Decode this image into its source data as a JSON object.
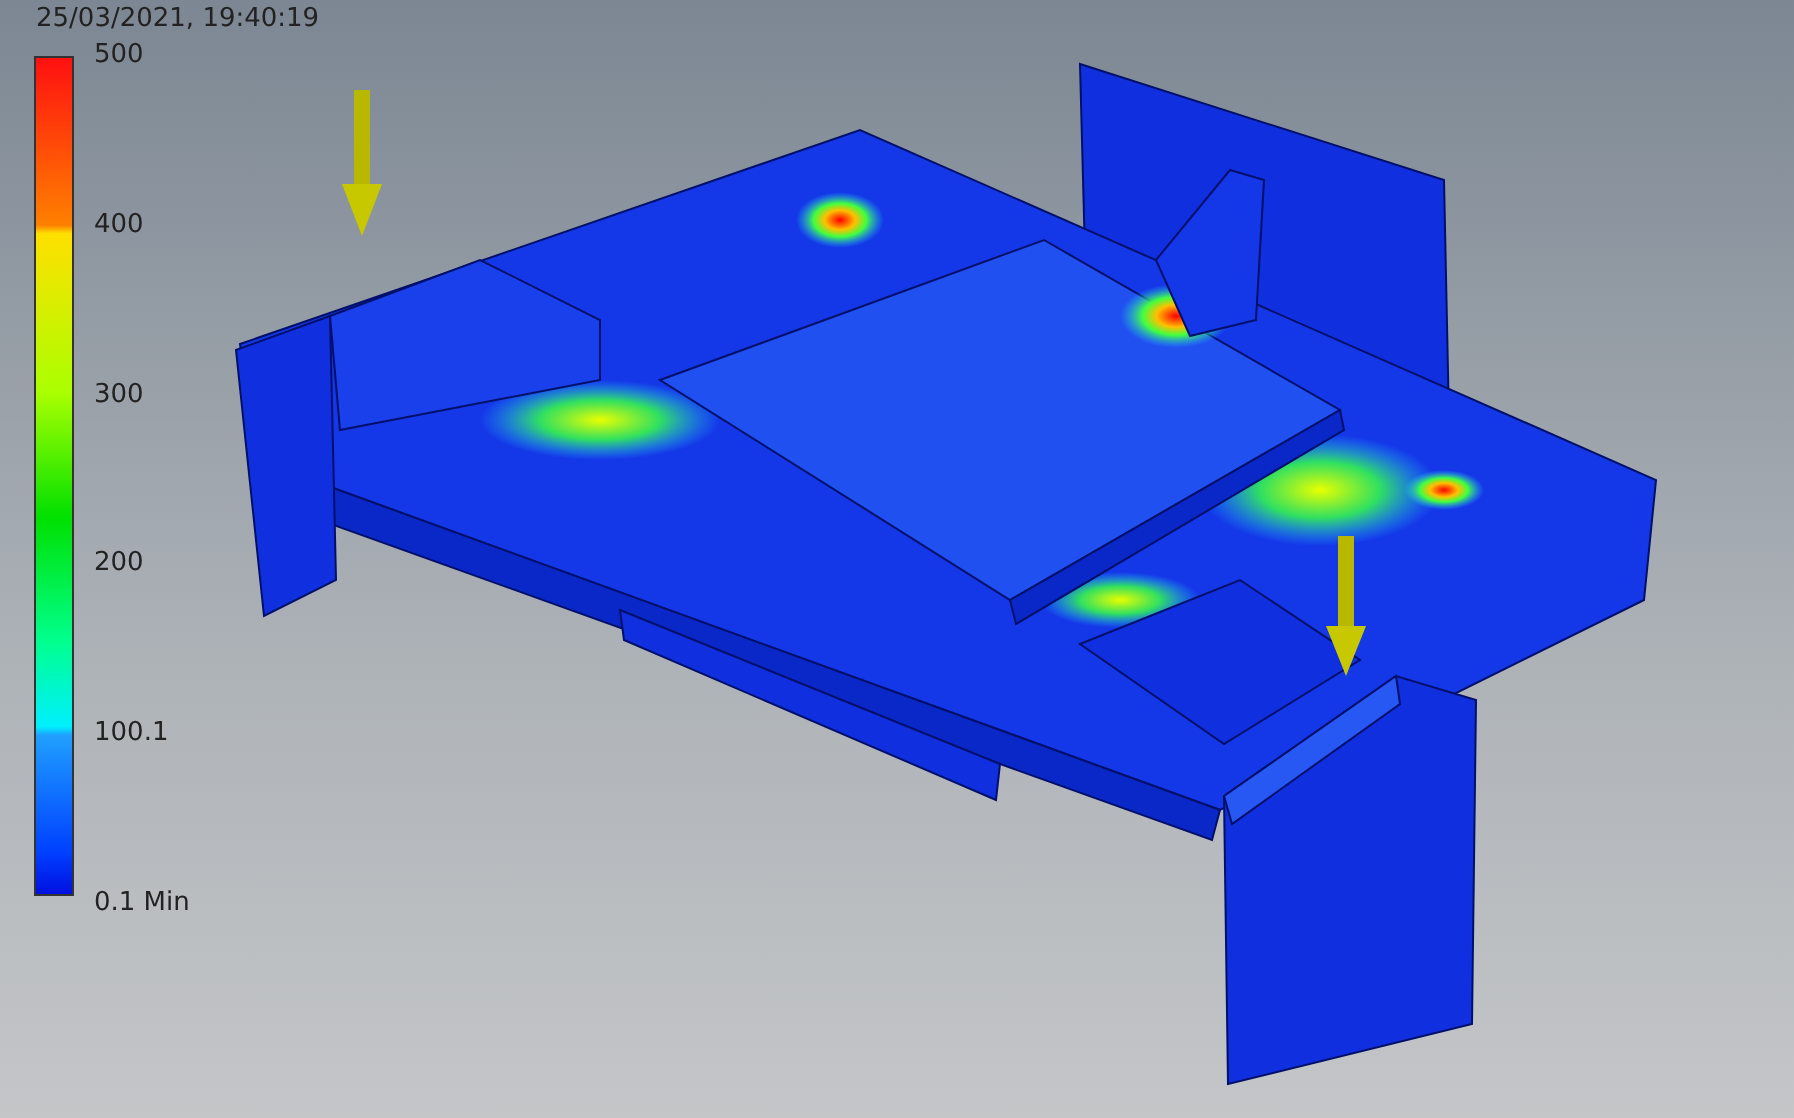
{
  "timestamp": "25/03/2021, 19:40:19",
  "legend": {
    "labels": [
      "500",
      "400",
      "300",
      "200",
      "100.1",
      "0.1 Min"
    ]
  }
}
